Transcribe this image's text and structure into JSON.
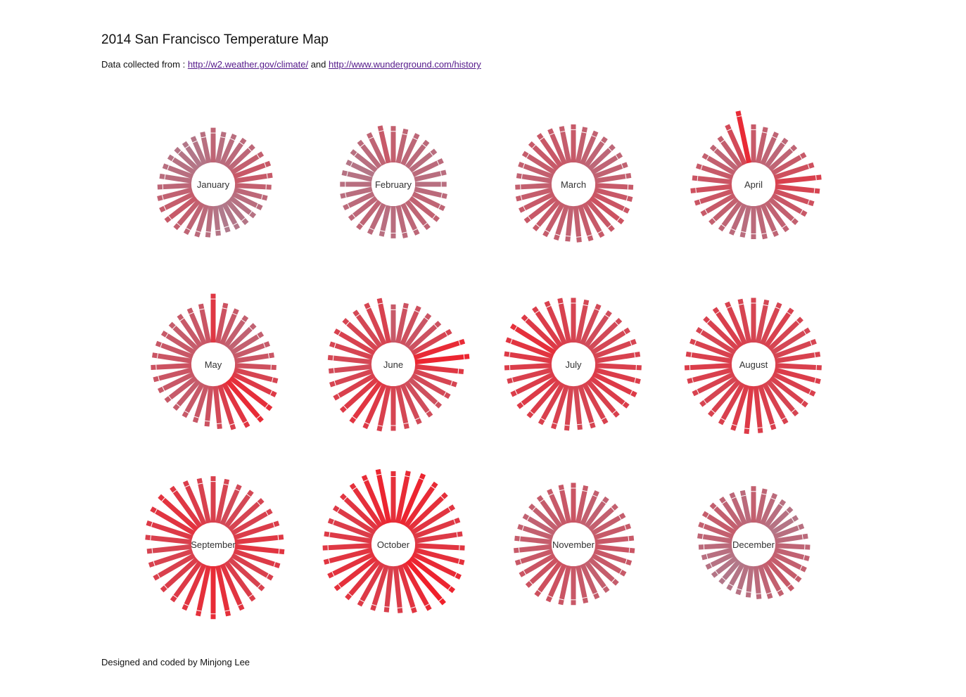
{
  "page": {
    "title": "2014 San Francisco Temperature Map",
    "subtitle_prefix": "Data collected from : ",
    "link1": "http://w2.weather.gov/climate/",
    "subtitle_and": " and ",
    "link2": "http://www.wunderground.com/history",
    "footer": "Designed and coded by Minjong Lee"
  },
  "chart_data": {
    "type": "radial-bar",
    "value_encoding": "relative daily temperature (bar length); approximate, read from bar lengths",
    "color_low": "#b07a8c",
    "color_high": "#f0202a",
    "months": [
      {
        "name": "January",
        "values": [
          88,
          84,
          85,
          86,
          87,
          90,
          93,
          92,
          90,
          87,
          85,
          83,
          82,
          81,
          80,
          82,
          84,
          86,
          88,
          90,
          92,
          91,
          89,
          87,
          85,
          84,
          83,
          82,
          81,
          82,
          84
        ]
      },
      {
        "name": "February",
        "values": [
          90,
          88,
          87,
          86,
          85,
          86,
          85,
          84,
          86,
          88,
          89,
          88,
          87,
          86,
          85,
          84,
          86,
          88,
          87,
          86,
          85,
          84,
          83,
          82,
          84,
          86,
          88,
          92
        ]
      },
      {
        "name": "March",
        "values": [
          92,
          90,
          89,
          88,
          87,
          88,
          89,
          90,
          92,
          93,
          94,
          95,
          93,
          92,
          91,
          90,
          89,
          90,
          91,
          92,
          93,
          92,
          91,
          90,
          89,
          90,
          91,
          92,
          93,
          92,
          91
        ]
      },
      {
        "name": "April",
        "values": [
          92,
          90,
          88,
          87,
          88,
          92,
          96,
          102,
          100,
          96,
          93,
          90,
          89,
          88,
          87,
          86,
          85,
          86,
          88,
          90,
          92,
          94,
          96,
          94,
          92,
          90,
          88,
          90,
          98,
          110
        ]
      },
      {
        "name": "May",
        "values": [
          105,
          95,
          92,
          90,
          89,
          90,
          92,
          94,
          96,
          100,
          104,
          108,
          110,
          106,
          102,
          98,
          95,
          93,
          92,
          91,
          92,
          93,
          94,
          95,
          94,
          93,
          92,
          91,
          92,
          93,
          94
        ]
      },
      {
        "name": "June",
        "values": [
          92,
          95,
          96,
          94,
          95,
          100,
          110,
          112,
          105,
          100,
          98,
          96,
          97,
          98,
          99,
          100,
          102,
          104,
          106,
          104,
          102,
          100,
          98,
          99,
          100,
          101,
          100,
          99,
          100,
          101
        ]
      },
      {
        "name": "July",
        "values": [
          100,
          99,
          98,
          97,
          98,
          99,
          100,
          101,
          102,
          103,
          104,
          103,
          102,
          101,
          100,
          99,
          100,
          101,
          102,
          103,
          104,
          103,
          102,
          103,
          104,
          106,
          108,
          104,
          103,
          102,
          101
        ]
      },
      {
        "name": "August",
        "values": [
          100,
          99,
          100,
          101,
          100,
          99,
          100,
          101,
          102,
          103,
          102,
          101,
          100,
          101,
          102,
          103,
          104,
          103,
          102,
          101,
          100,
          101,
          102,
          103,
          102,
          101,
          100,
          101,
          102,
          101,
          100
        ]
      },
      {
        "name": "September",
        "values": [
          102,
          100,
          98,
          99,
          100,
          101,
          103,
          105,
          106,
          104,
          102,
          101,
          103,
          106,
          108,
          110,
          108,
          106,
          104,
          103,
          102,
          101,
          100,
          102,
          104,
          106,
          107,
          105,
          103,
          101
        ]
      },
      {
        "name": "October",
        "values": [
          108,
          110,
          112,
          110,
          108,
          106,
          105,
          104,
          106,
          108,
          110,
          112,
          114,
          110,
          106,
          103,
          102,
          103,
          104,
          106,
          108,
          107,
          106,
          105,
          104,
          103,
          104,
          106,
          108,
          110,
          112
        ]
      },
      {
        "name": "November",
        "values": [
          94,
          92,
          90,
          89,
          90,
          91,
          92,
          93,
          94,
          93,
          92,
          91,
          90,
          91,
          92,
          93,
          94,
          95,
          96,
          95,
          94,
          93,
          92,
          91,
          90,
          89,
          90,
          91,
          92,
          93
        ]
      },
      {
        "name": "December",
        "values": [
          90,
          88,
          86,
          84,
          83,
          82,
          84,
          86,
          88,
          89,
          90,
          91,
          92,
          90,
          88,
          86,
          84,
          83,
          82,
          81,
          82,
          83,
          84,
          86,
          88,
          90,
          91,
          90,
          88,
          87,
          86
        ]
      }
    ]
  }
}
